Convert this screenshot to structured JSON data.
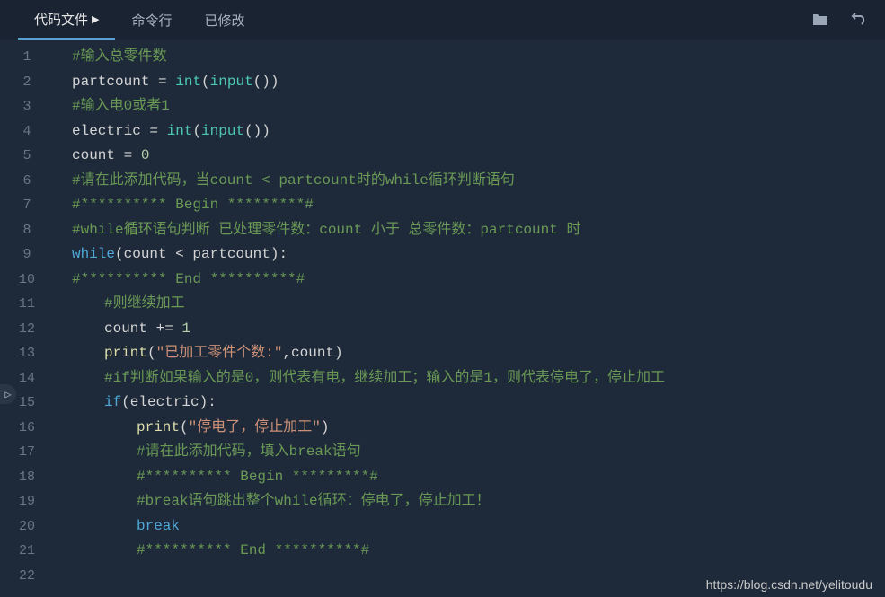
{
  "tabs": {
    "code": "代码文件",
    "cmd": "命令行",
    "modified": "已修改"
  },
  "lines": [
    [
      {
        "t": "comment",
        "v": "#输入总零件数"
      }
    ],
    [
      {
        "t": "ident",
        "v": "partcount"
      },
      {
        "t": "punc",
        "v": " = "
      },
      {
        "t": "builtin",
        "v": "int"
      },
      {
        "t": "punc",
        "v": "("
      },
      {
        "t": "builtin",
        "v": "input"
      },
      {
        "t": "punc",
        "v": "())"
      }
    ],
    [
      {
        "t": "comment",
        "v": "#输入电0或者1"
      }
    ],
    [
      {
        "t": "ident",
        "v": "electric"
      },
      {
        "t": "punc",
        "v": " = "
      },
      {
        "t": "builtin",
        "v": "int"
      },
      {
        "t": "punc",
        "v": "("
      },
      {
        "t": "builtin",
        "v": "input"
      },
      {
        "t": "punc",
        "v": "())"
      }
    ],
    [
      {
        "t": "ident",
        "v": "count"
      },
      {
        "t": "punc",
        "v": " = "
      },
      {
        "t": "num",
        "v": "0"
      }
    ],
    [
      {
        "t": "comment",
        "v": "#请在此添加代码，当count < partcount时的while循环判断语句"
      }
    ],
    [
      {
        "t": "comment",
        "v": "#********** Begin *********#"
      }
    ],
    [
      {
        "t": "comment",
        "v": "#while循环语句判断 已处理零件数：count 小于 总零件数：partcount 时"
      }
    ],
    [
      {
        "t": "keyword",
        "v": "while"
      },
      {
        "t": "punc",
        "v": "(count < partcount):"
      }
    ],
    [
      {
        "t": "comment",
        "v": "#********** End **********#"
      }
    ],
    [
      {
        "t": "indent",
        "v": 1
      },
      {
        "t": "comment",
        "v": "#则继续加工"
      }
    ],
    [
      {
        "t": "indent",
        "v": 1
      },
      {
        "t": "ident",
        "v": "count"
      },
      {
        "t": "punc",
        "v": " += "
      },
      {
        "t": "num",
        "v": "1"
      }
    ],
    [
      {
        "t": "indent",
        "v": 1
      },
      {
        "t": "func",
        "v": "print"
      },
      {
        "t": "punc",
        "v": "("
      },
      {
        "t": "str",
        "v": "\"已加工零件个数:\""
      },
      {
        "t": "punc",
        "v": ",count)"
      }
    ],
    [
      {
        "t": "indent",
        "v": 1
      },
      {
        "t": "comment",
        "v": "#if判断如果输入的是0，则代表有电，继续加工；输入的是1，则代表停电了，停止加工"
      }
    ],
    [
      {
        "t": "indent",
        "v": 1
      },
      {
        "t": "keyword",
        "v": "if"
      },
      {
        "t": "punc",
        "v": "(electric):"
      }
    ],
    [
      {
        "t": "indent",
        "v": 2
      },
      {
        "t": "func",
        "v": "print"
      },
      {
        "t": "punc",
        "v": "("
      },
      {
        "t": "str",
        "v": "\"停电了，停止加工\""
      },
      {
        "t": "punc",
        "v": ")"
      }
    ],
    [
      {
        "t": "indent",
        "v": 2
      },
      {
        "t": "comment",
        "v": "#请在此添加代码，填入break语句"
      }
    ],
    [
      {
        "t": "indent",
        "v": 2
      },
      {
        "t": "comment",
        "v": "#********** Begin *********#"
      }
    ],
    [
      {
        "t": "indent",
        "v": 2
      },
      {
        "t": "comment",
        "v": "#break语句跳出整个while循环：停电了，停止加工！"
      }
    ],
    [
      {
        "t": "indent",
        "v": 2
      },
      {
        "t": "keyword",
        "v": "break"
      }
    ],
    [
      {
        "t": "indent",
        "v": 2
      },
      {
        "t": "comment",
        "v": "#********** End **********#"
      }
    ],
    []
  ],
  "watermark": "https://blog.csdn.net/yelitoudu"
}
